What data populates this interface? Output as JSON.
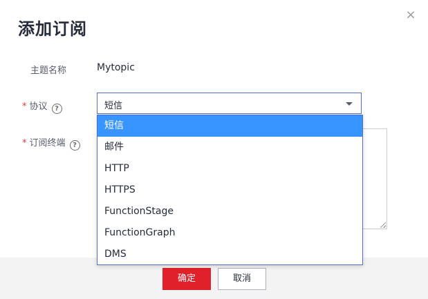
{
  "dialog": {
    "title": "添加订阅",
    "close_glyph": "×"
  },
  "form": {
    "topic_label": "主题名称",
    "topic_value": "Mytopic",
    "protocol_label": "协议",
    "protocol_value": "短信",
    "endpoint_label": "订阅终端",
    "required_mark": "*",
    "help_glyph": "?"
  },
  "dropdown": {
    "options": [
      "短信",
      "邮件",
      "HTTP",
      "HTTPS",
      "FunctionStage",
      "FunctionGraph",
      "DMS"
    ],
    "selected_index": 0
  },
  "footer": {
    "confirm_label": "确定",
    "cancel_label": "取消"
  },
  "colors": {
    "accent": "#526ecc",
    "selected_option": "#3894ff",
    "confirm_button": "#e0202b",
    "required": "#e4393c"
  },
  "icons": {
    "close": "close-icon",
    "help": "question-circle-icon",
    "caret": "caret-down-icon",
    "resize": "resize-handle-icon"
  }
}
